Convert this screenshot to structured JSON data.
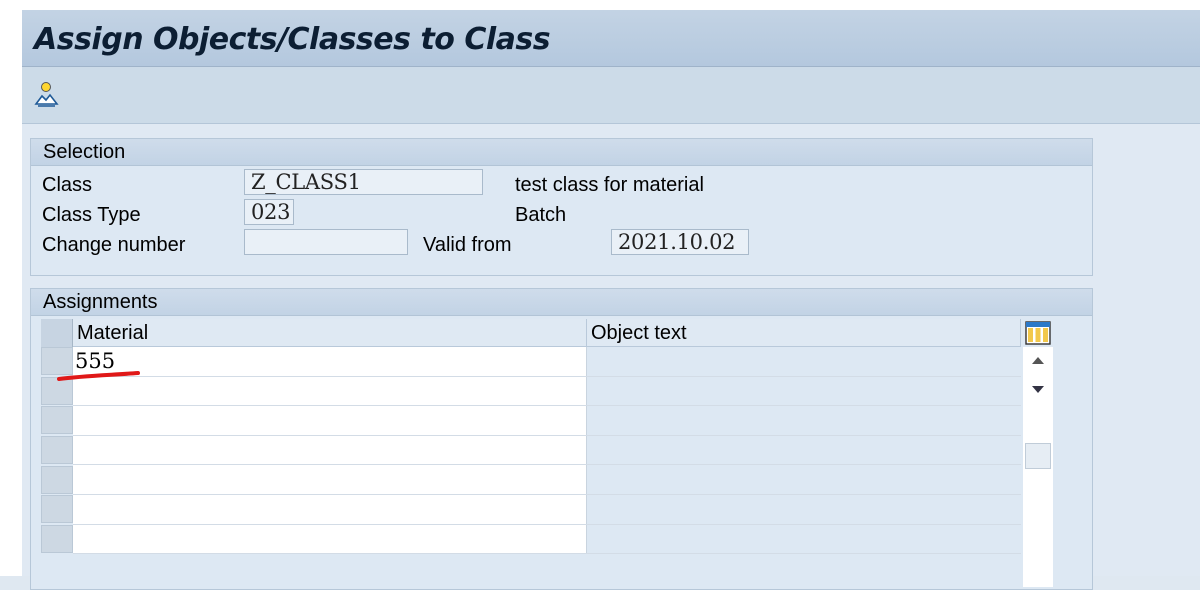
{
  "title": "Assign Objects/Classes to Class",
  "toolbar": {
    "icon": "person-mountain-icon"
  },
  "selection": {
    "header": "Selection",
    "class_label": "Class",
    "class_value": "Z_CLASS1",
    "class_desc": "test class for material",
    "class_type_label": "Class Type",
    "class_type_value": "023",
    "class_type_desc": "Batch",
    "change_number_label": "Change number",
    "change_number_value": "",
    "valid_from_label": "Valid from",
    "valid_from_value": "2021.10.02"
  },
  "assignments": {
    "header": "Assignments",
    "columns": {
      "material": "Material",
      "object_text": "Object text"
    },
    "rows": [
      {
        "material": "555",
        "object_text": ""
      },
      {
        "material": "",
        "object_text": ""
      },
      {
        "material": "",
        "object_text": ""
      },
      {
        "material": "",
        "object_text": ""
      },
      {
        "material": "",
        "object_text": ""
      },
      {
        "material": "",
        "object_text": ""
      },
      {
        "material": "",
        "object_text": ""
      }
    ]
  },
  "colors": {
    "title_text": "#0c1e33",
    "annotation_mark": "#e01818"
  }
}
